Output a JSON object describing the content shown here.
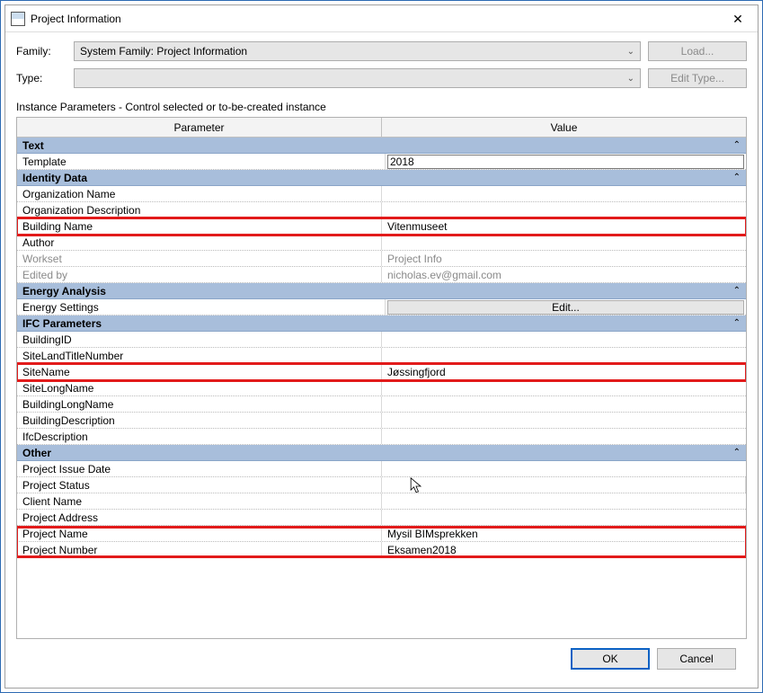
{
  "window": {
    "title": "Project Information"
  },
  "top": {
    "family_label": "Family:",
    "family_value": "System Family: Project Information",
    "type_label": "Type:",
    "type_value": "",
    "load_btn": "Load...",
    "edit_type_btn": "Edit Type..."
  },
  "instance_label": "Instance Parameters - Control selected or to-be-created instance",
  "headers": {
    "param": "Parameter",
    "value": "Value"
  },
  "groups": {
    "text": "Text",
    "identity": "Identity Data",
    "energy": "Energy Analysis",
    "ifc": "IFC Parameters",
    "other": "Other"
  },
  "params": {
    "template_label": "Template",
    "template_value": "2018",
    "org_name_label": "Organization Name",
    "org_name_value": "",
    "org_desc_label": "Organization Description",
    "org_desc_value": "",
    "building_name_label": "Building Name",
    "building_name_value": "Vitenmuseet",
    "author_label": "Author",
    "author_value": "",
    "workset_label": "Workset",
    "workset_value": "Project Info",
    "edited_by_label": "Edited by",
    "edited_by_value": "nicholas.ev@gmail.com",
    "energy_settings_label": "Energy Settings",
    "energy_edit_btn": "Edit...",
    "building_id_label": "BuildingID",
    "building_id_value": "",
    "site_land_label": "SiteLandTitleNumber",
    "site_land_value": "",
    "site_name_label": "SiteName",
    "site_name_value": "Jøssingfjord",
    "site_long_label": "SiteLongName",
    "site_long_value": "",
    "building_long_label": "BuildingLongName",
    "building_long_value": "",
    "building_desc_label": "BuildingDescription",
    "building_desc_value": "",
    "ifc_desc_label": "IfcDescription",
    "ifc_desc_value": "",
    "issue_date_label": "Project Issue Date",
    "issue_date_value": "",
    "status_label": "Project Status",
    "status_value": "",
    "client_label": "Client Name",
    "client_value": "",
    "address_label": "Project Address",
    "address_value": "",
    "project_name_label": "Project Name",
    "project_name_value": "Mysil BIMsprekken",
    "project_number_label": "Project Number",
    "project_number_value": "Eksamen2018"
  },
  "footer": {
    "ok": "OK",
    "cancel": "Cancel"
  },
  "collapse_glyph": "«"
}
